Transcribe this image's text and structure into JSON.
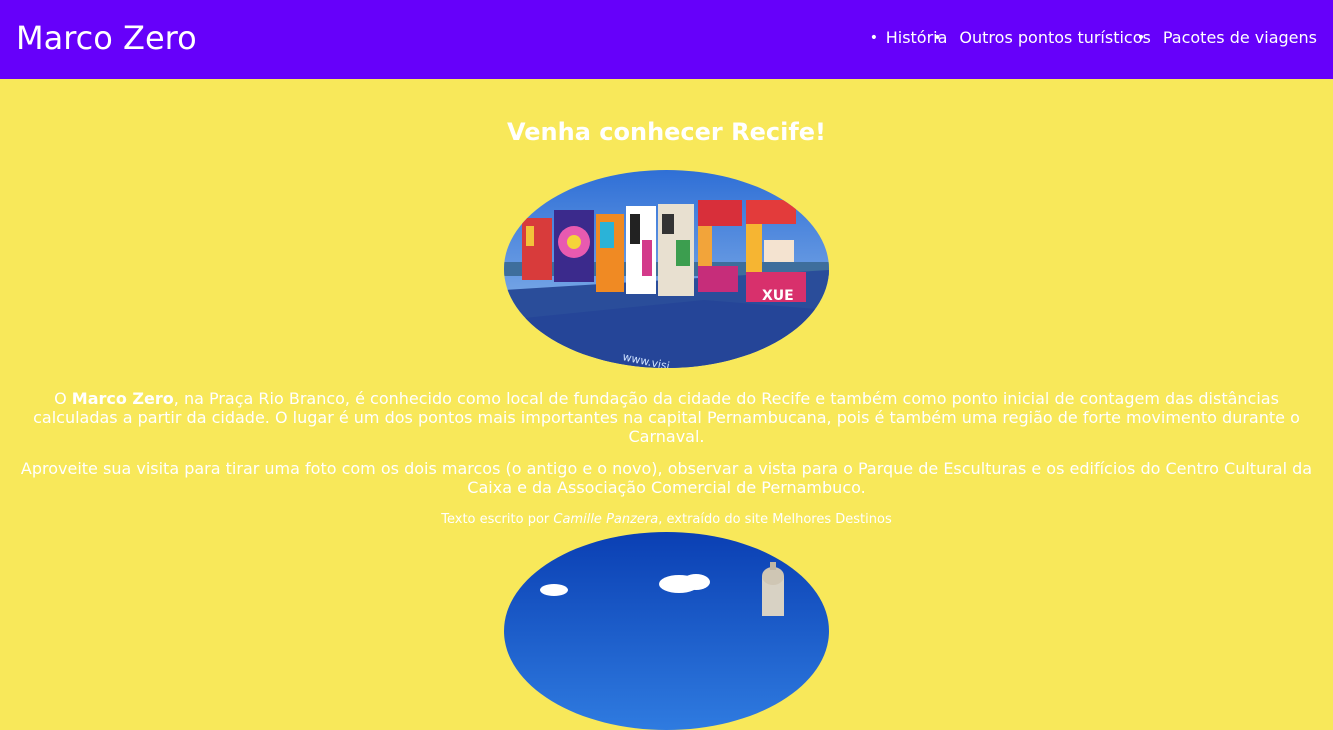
{
  "header": {
    "brand": "Marco Zero",
    "nav": [
      {
        "label": "História"
      },
      {
        "label": "Outros pontos turísticos"
      },
      {
        "label": "Pacotes de viagens"
      }
    ]
  },
  "main": {
    "heading": "Venha conhecer Recife!",
    "paragraph1": {
      "before": "O ",
      "bold": "Marco Zero",
      "after": ", na Praça Rio Branco, é conhecido como local de fundação da cidade do Recife e também como ponto inicial de contagem das distâncias calculadas a partir da cidade. O lugar é um dos pontos mais importantes na capital Pernambucana, pois é também uma região de forte movimento durante o Carnaval."
    },
    "paragraph2": "Aproveite sua visita para tirar uma foto com os dois marcos (o antigo e o novo), observar a vista para o Parque de Esculturas e os edifícios do Centro Cultural da Caixa e da Associação Comercial de Pernambuco.",
    "credit": {
      "before": "Texto escrito por ",
      "author": "Camille Panzera",
      "after": ", extraído do site Melhores Destinos"
    }
  },
  "colors": {
    "header_bg": "#6600fa",
    "page_bg": "#f8e85a",
    "text": "#ffffff"
  }
}
